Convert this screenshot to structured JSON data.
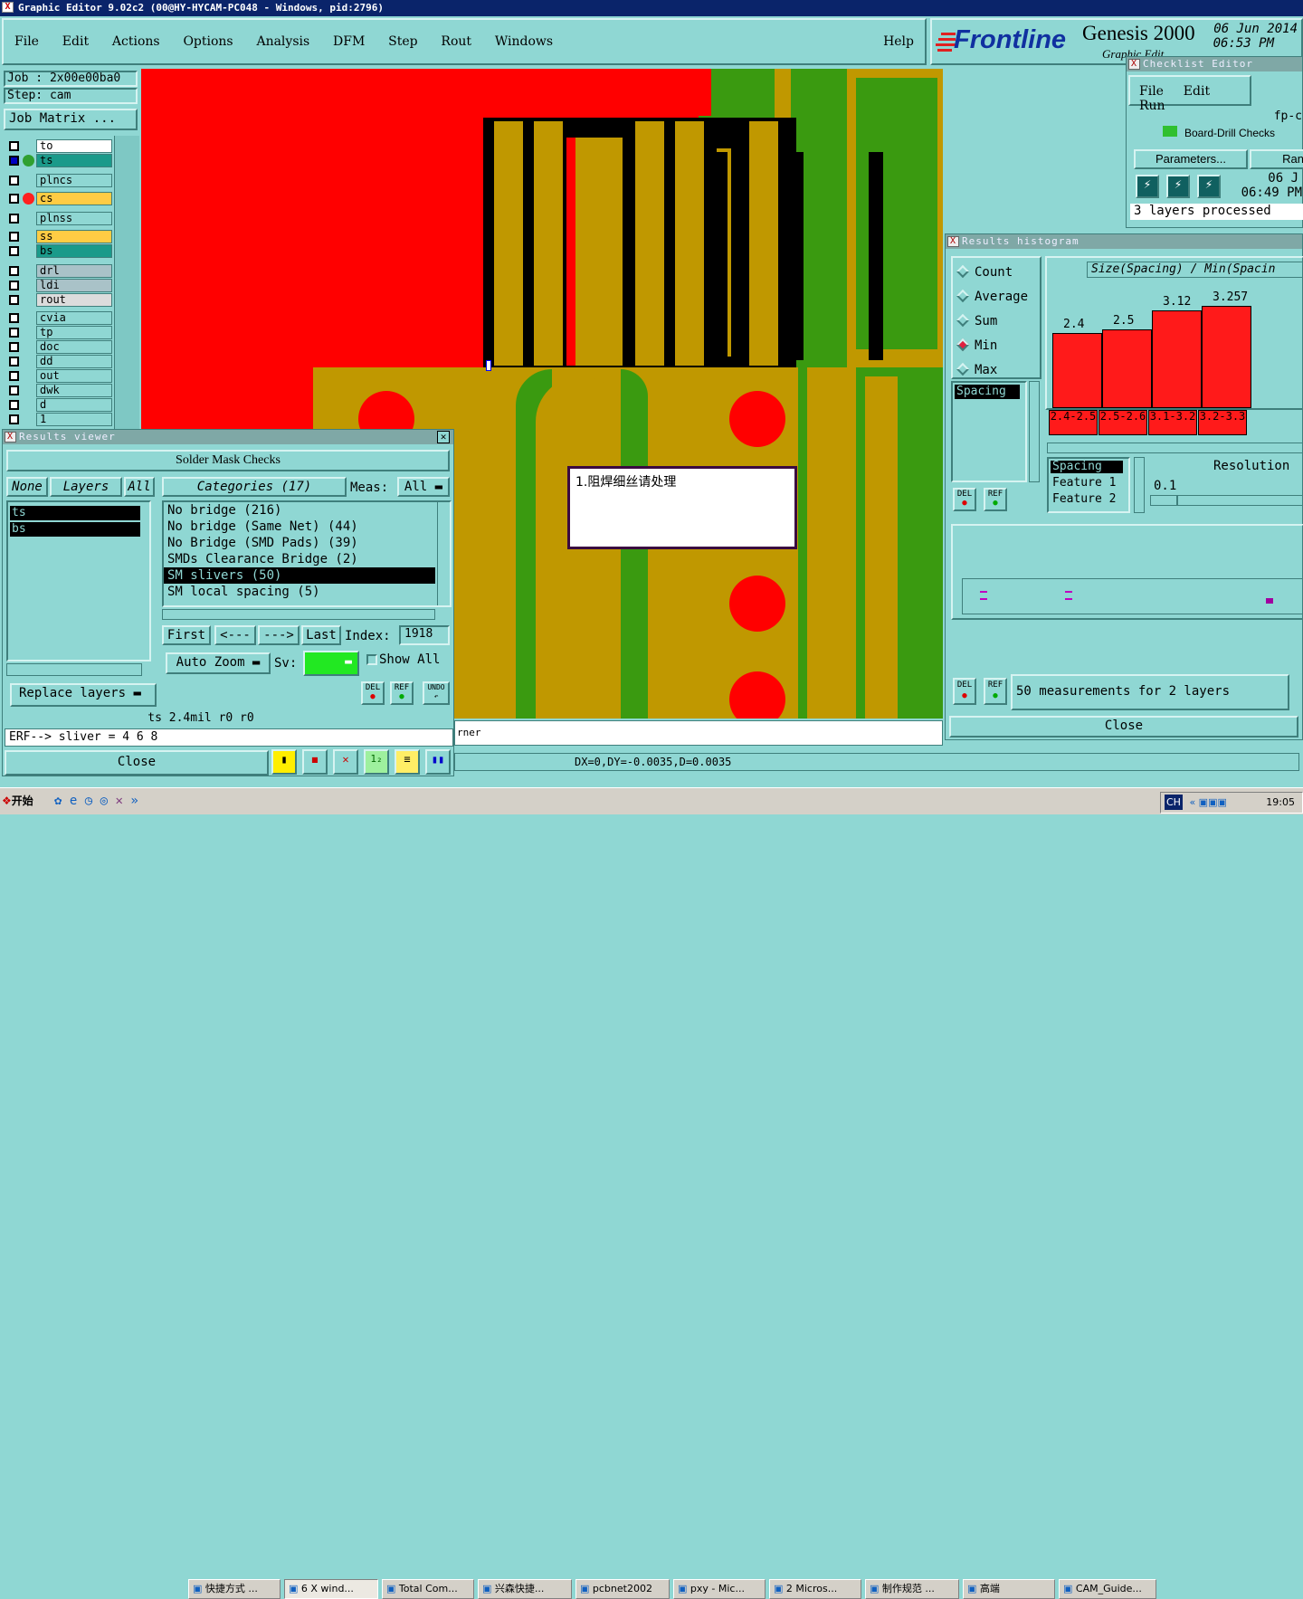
{
  "app": {
    "title": "Graphic Editor 9.02c2 (00@HY-HYCAM-PC048 - Windows, pid:2796)"
  },
  "menu": {
    "items": [
      "File",
      "Edit",
      "Actions",
      "Options",
      "Analysis",
      "DFM",
      "Step",
      "Rout",
      "Windows"
    ],
    "help": "Help"
  },
  "brand": {
    "logo": "Frontline",
    "product": "Genesis 2000",
    "date": "06 Jun 2014",
    "time": "06:53 PM",
    "sub": "Graphic Edit"
  },
  "job": {
    "job": "Job  : 2x00e00ba0",
    "step": "Step: cam",
    "matrix": "Job Matrix ..."
  },
  "layers": [
    {
      "name": "to",
      "color": "#ffffff"
    },
    {
      "name": "ts",
      "color": "#1a9a8a"
    },
    {
      "name": "plncs",
      "color": "#8fd7d3"
    },
    {
      "name": "cs",
      "color": "#ffcc44"
    },
    {
      "name": "plnss",
      "color": "#8fd7d3"
    },
    {
      "name": "ss",
      "color": "#ffcc44"
    },
    {
      "name": "bs",
      "color": "#1a9a8a"
    },
    {
      "name": "drl",
      "color": "#a9c2c8"
    },
    {
      "name": "ldi",
      "color": "#a9c2c8"
    },
    {
      "name": "rout",
      "color": "#dcdcdc"
    },
    {
      "name": "cvia",
      "color": "#8fd7d3"
    },
    {
      "name": "tp",
      "color": "#8fd7d3"
    },
    {
      "name": "doc",
      "color": "#8fd7d3"
    },
    {
      "name": "dd",
      "color": "#8fd7d3"
    },
    {
      "name": "out",
      "color": "#8fd7d3"
    },
    {
      "name": "dwk",
      "color": "#8fd7d3"
    },
    {
      "name": "d",
      "color": "#8fd7d3"
    },
    {
      "name": "1",
      "color": "#8fd7d3"
    }
  ],
  "results_viewer": {
    "title": "Results viewer",
    "header": "Solder Mask Checks",
    "none": "None",
    "layers_btn": "Layers",
    "all": "All",
    "layer_list": [
      "ts",
      "bs"
    ],
    "categories_btn": "Categories (17)",
    "meas_label": "Meas:",
    "meas_value": "All",
    "categories": [
      "No bridge (216)",
      "No bridge (Same Net) (44)",
      "No Bridge (SMD Pads) (39)",
      "SMDs Clearance Bridge (2)",
      "SM slivers (50)",
      "SM local spacing (5)"
    ],
    "selected_index": 4,
    "first": "First",
    "prev": "<---",
    "next": "--->",
    "last": "Last",
    "index_label": "Index:",
    "index_value": "1918",
    "auto_zoom": "Auto Zoom",
    "sv": "Sv:",
    "show_all": "Show All",
    "replace_layers": "Replace layers",
    "del": "DEL",
    "ref": "REF",
    "undo": "UNDO",
    "status": "ts 2.4mil   r0   r0",
    "erf": "ERF--> sliver = 4 6 8",
    "close": "Close"
  },
  "canvas": {
    "note": "1.阻焊细丝请处理",
    "status_corner": "rner",
    "coords": "DX=0,DY=-0.0035,D=0.0035"
  },
  "checklist": {
    "title": "Checklist Editor",
    "menu": [
      "File",
      "Edit",
      "Run"
    ],
    "fp": "fp-c",
    "item": "Board-Drill Checks",
    "params": "Parameters...",
    "run": "Ran",
    "date": "06 J",
    "time": "06:49 PM",
    "processed": "3 layers processed"
  },
  "histogram": {
    "title": "Results histogram",
    "options": [
      "Count",
      "Average",
      "Sum",
      "Min",
      "Max"
    ],
    "selected": "Min",
    "list": [
      "Spacing"
    ],
    "chart_title": "Size(Spacing) / Min(Spacin",
    "feature_list": [
      "Spacing",
      "Feature 1",
      "Feature 2"
    ],
    "resolution_label": "Resolution",
    "resolution_value": "0.1",
    "del": "DEL",
    "ref": "REF",
    "summary": "50 measurements for 2 layers",
    "close": "Close"
  },
  "chart_data": {
    "type": "bar",
    "categories": [
      "2.4-2.5",
      "2.5-2.6",
      "3.1-3.2",
      "3.2-3.3"
    ],
    "values": [
      2.4,
      2.5,
      3.12,
      3.257
    ],
    "title": "Size(Spacing) / Min(Spacin",
    "ylim": [
      0,
      3.6
    ]
  },
  "taskbar": {
    "start": "开始",
    "items": [
      "快捷方式 ...",
      "6 X wind...",
      "Total Com...",
      "兴森快捷...",
      "pcbnet2002",
      "pxy - Mic...",
      "2 Micros...",
      "制作规范 ...",
      "高端",
      "CAM_Guide..."
    ],
    "clock": "19:05",
    "lang": "CH"
  }
}
